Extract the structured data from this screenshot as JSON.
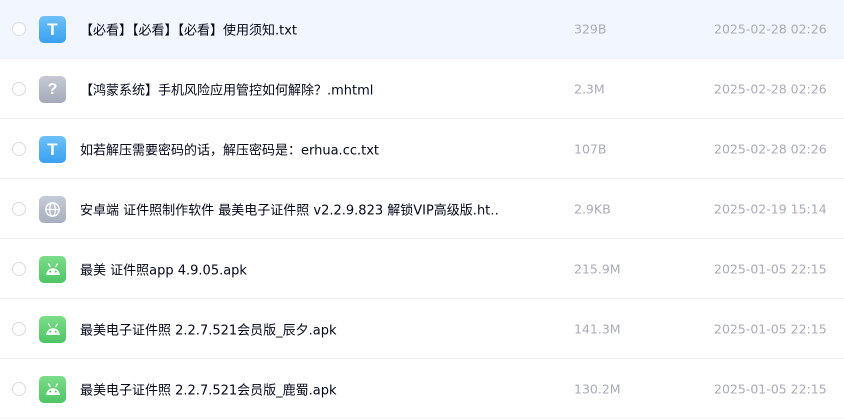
{
  "files": [
    {
      "icon": "txt-file-icon",
      "glyph": "T",
      "name": "【必看】【必看】【必看】使用须知.txt",
      "size": "329B",
      "date": "2025-02-28 02:26"
    },
    {
      "icon": "unknown-file-icon",
      "glyph": "?",
      "name": "【鸿蒙系统】手机风险应用管控如何解除？.mhtml",
      "size": "2.3M",
      "date": "2025-02-28 02:26"
    },
    {
      "icon": "txt-file-icon",
      "glyph": "T",
      "name": "如若解压需要密码的话，解压密码是：erhua.cc.txt",
      "size": "107B",
      "date": "2025-02-28 02:26"
    },
    {
      "icon": "web-file-icon",
      "glyph": "",
      "name": "安卓端 证件照制作软件 最美电子证件照 v2.2.9.823 解锁VIP高级版.ht…",
      "size": "2.9KB",
      "date": "2025-02-19 15:14"
    },
    {
      "icon": "apk-file-icon",
      "glyph": "",
      "name": "最美 证件照app 4.9.05.apk",
      "size": "215.9M",
      "date": "2025-01-05 22:15"
    },
    {
      "icon": "apk-file-icon",
      "glyph": "",
      "name": "最美电子证件照 2.2.7.521会员版_辰夕.apk",
      "size": "141.3M",
      "date": "2025-01-05 22:15"
    },
    {
      "icon": "apk-file-icon",
      "glyph": "",
      "name": "最美电子证件照 2.2.7.521会员版_鹿蜀.apk",
      "size": "130.2M",
      "date": "2025-01-05 22:15"
    }
  ]
}
